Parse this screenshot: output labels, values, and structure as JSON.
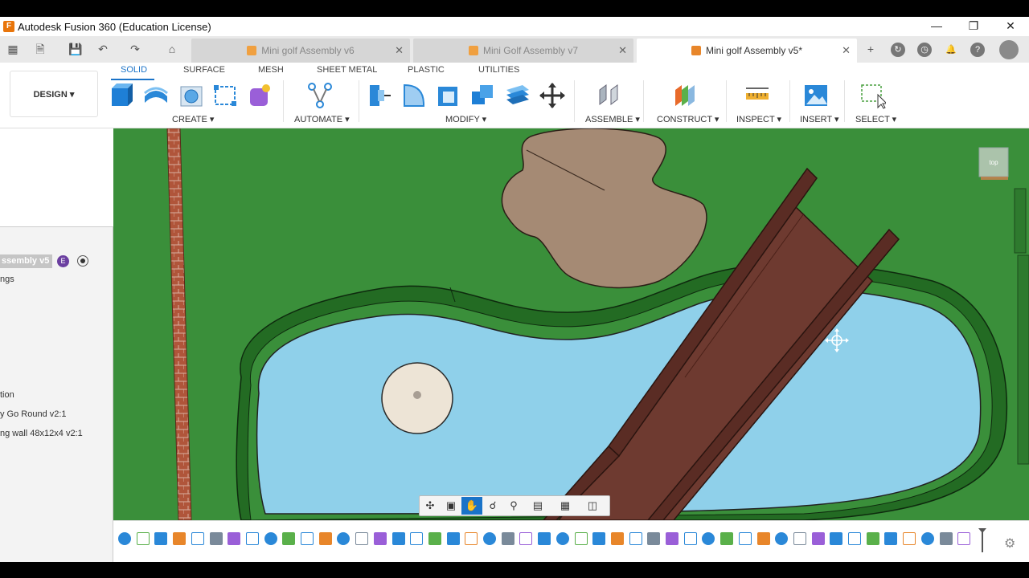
{
  "window": {
    "title": "Autodesk Fusion 360 (Education License)",
    "app_icon_letter": "F"
  },
  "tabs": [
    {
      "label": "Mini golf Assembly v6",
      "active": false
    },
    {
      "label": "Mini Golf Assembly v7",
      "active": false
    },
    {
      "label": "Mini golf Assembly v5*",
      "active": true
    }
  ],
  "toolbar": {
    "workspace": "DESIGN ▾",
    "ribbon_tabs": [
      "SOLID",
      "SURFACE",
      "MESH",
      "SHEET METAL",
      "PLASTIC",
      "UTILITIES"
    ],
    "groups": [
      "CREATE ▾",
      "AUTOMATE ▾",
      "MODIFY ▾",
      "ASSEMBLE ▾",
      "CONSTRUCT ▾",
      "INSPECT ▾",
      "INSERT ▾",
      "SELECT ▾"
    ]
  },
  "browser": {
    "root": "ssembly v5",
    "badge": "E",
    "items": [
      "ngs",
      "tion",
      "y Go Round v2:1",
      "ng wall 48x12x4 v2:1"
    ]
  },
  "viewcube_label": "top",
  "colors": {
    "grass": "#3a8f3a",
    "water": "#8fd0ea",
    "bridge": "#6e3a30",
    "rock": "#a58a74",
    "accent": "#1a73c8"
  }
}
